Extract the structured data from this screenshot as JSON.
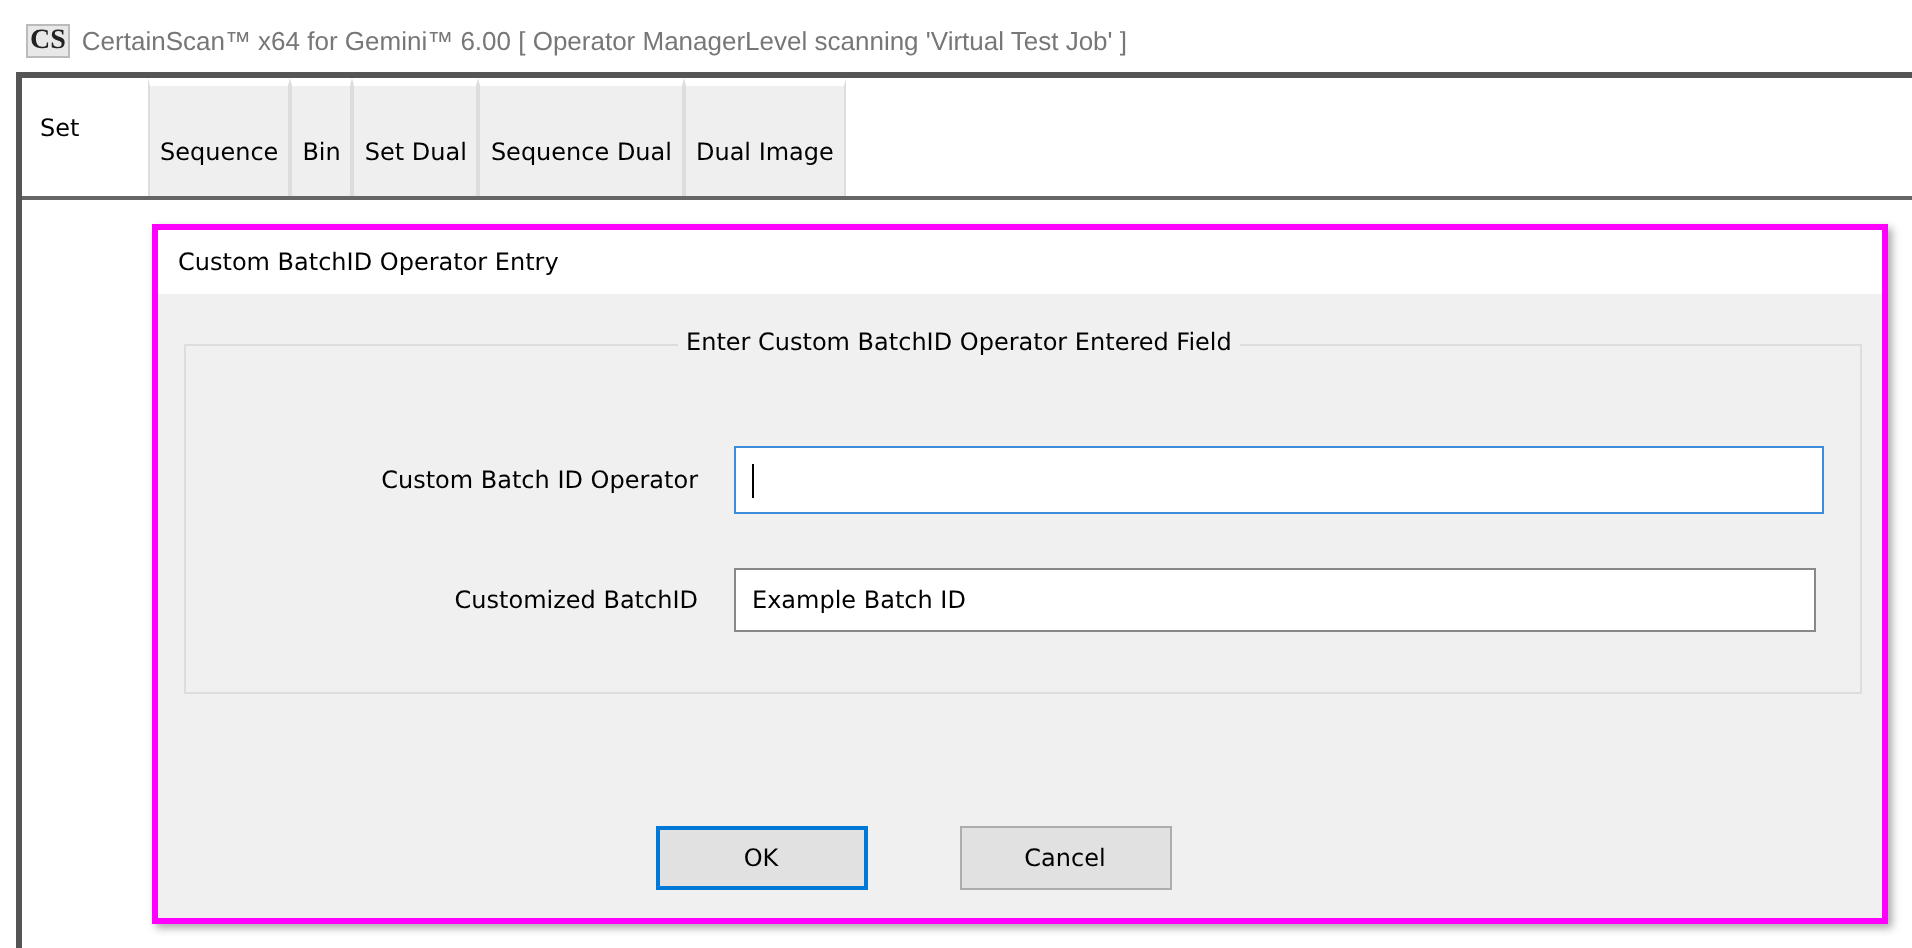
{
  "window": {
    "logo": "CS",
    "title": "CertainScan™ x64 for Gemini™ 6.00  [ Operator ManagerLevel scanning 'Virtual Test Job' ]"
  },
  "tabs": [
    {
      "label": "Set",
      "selected": true
    },
    {
      "label": "Sequence",
      "selected": false
    },
    {
      "label": "Bin",
      "selected": false
    },
    {
      "label": "Set Dual",
      "selected": false
    },
    {
      "label": "Sequence Dual",
      "selected": false
    },
    {
      "label": "Dual Image",
      "selected": false
    }
  ],
  "dialog": {
    "title": "Custom BatchID Operator Entry",
    "group_title": "Enter Custom BatchID Operator Entered Field",
    "fields": [
      {
        "label": "Custom Batch ID Operator",
        "focused": true
      },
      {
        "label": "Customized BatchID",
        "value": "Example Batch ID",
        "focused": false
      }
    ],
    "buttons": [
      {
        "label": "OK",
        "default": true
      },
      {
        "label": "Cancel",
        "default": false
      }
    ]
  }
}
